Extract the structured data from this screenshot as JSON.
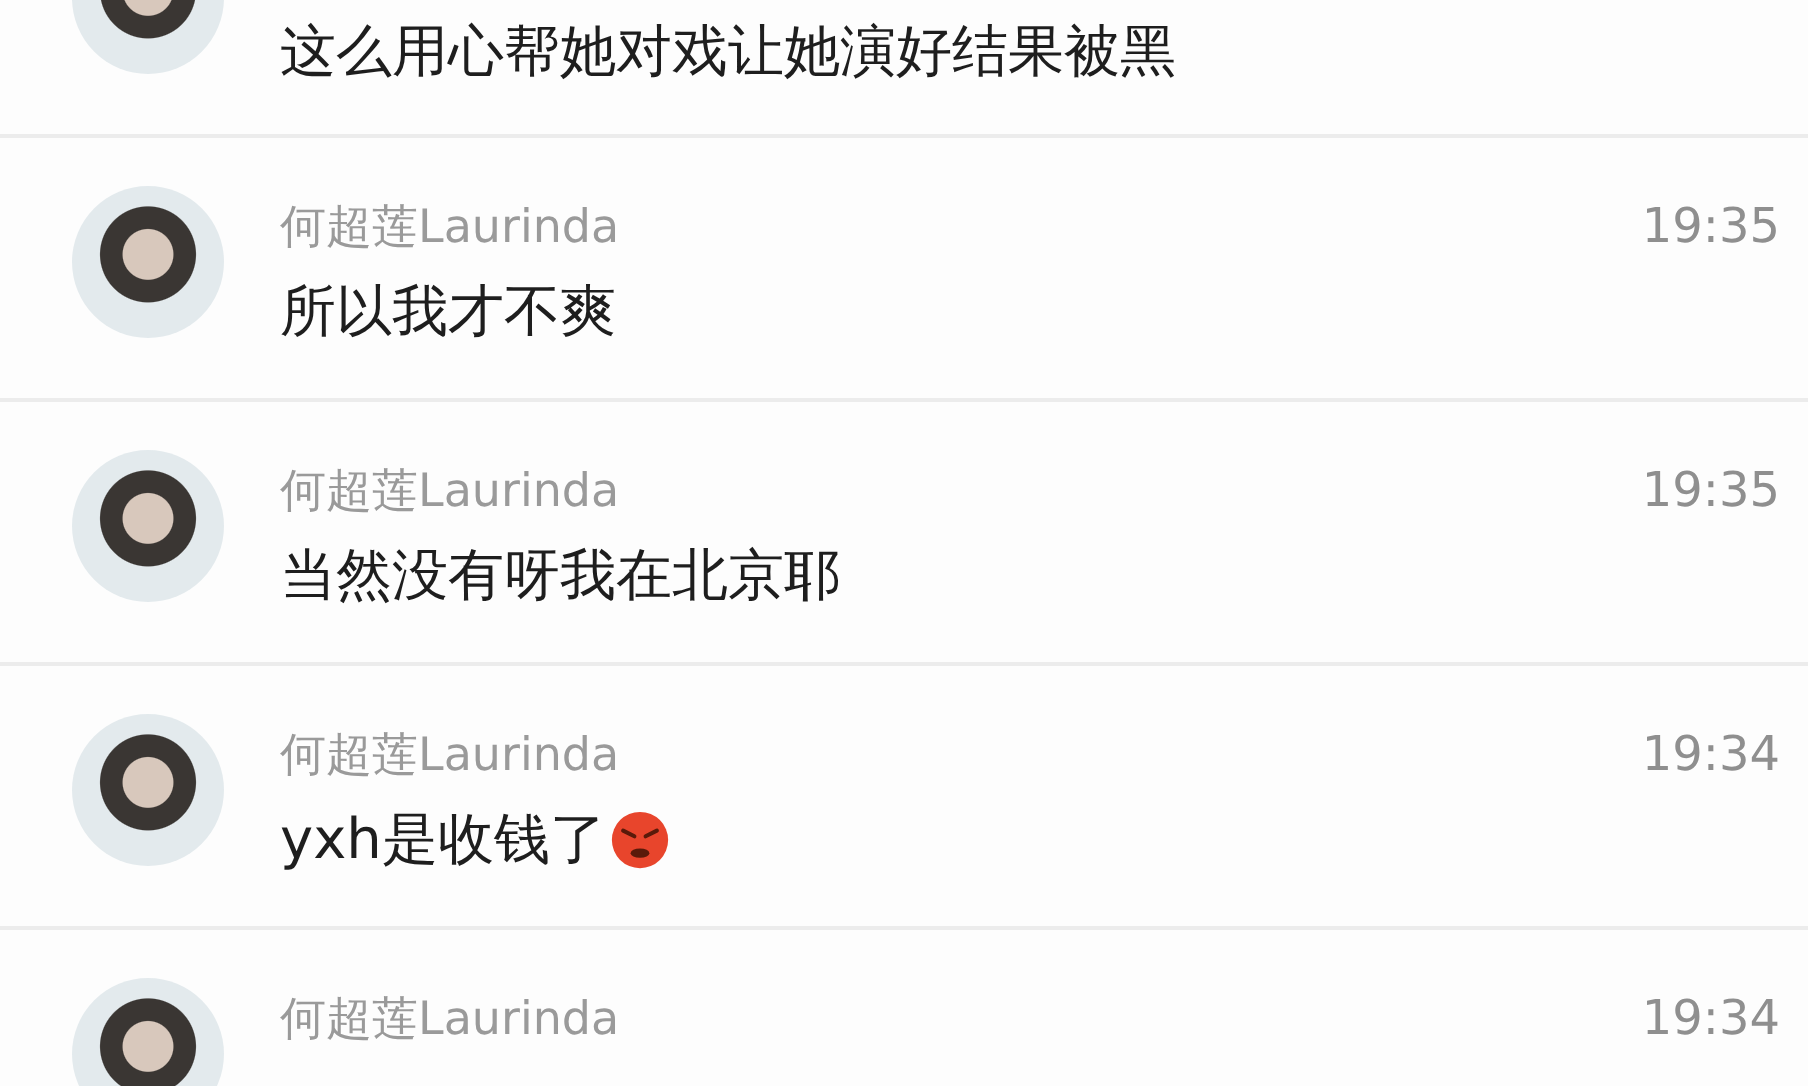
{
  "chats": [
    {
      "message": "这么用心帮她对戏让她演好结果被黑"
    },
    {
      "name": "何超莲Laurinda",
      "time": "19:35",
      "message": "所以我才不爽"
    },
    {
      "name": "何超莲Laurinda",
      "time": "19:35",
      "message": "当然没有呀我在北京耶"
    },
    {
      "name": "何超莲Laurinda",
      "time": "19:34",
      "message": "yxh是收钱了",
      "emoji": true
    },
    {
      "name": "何超莲Laurinda",
      "time": "19:34"
    }
  ]
}
